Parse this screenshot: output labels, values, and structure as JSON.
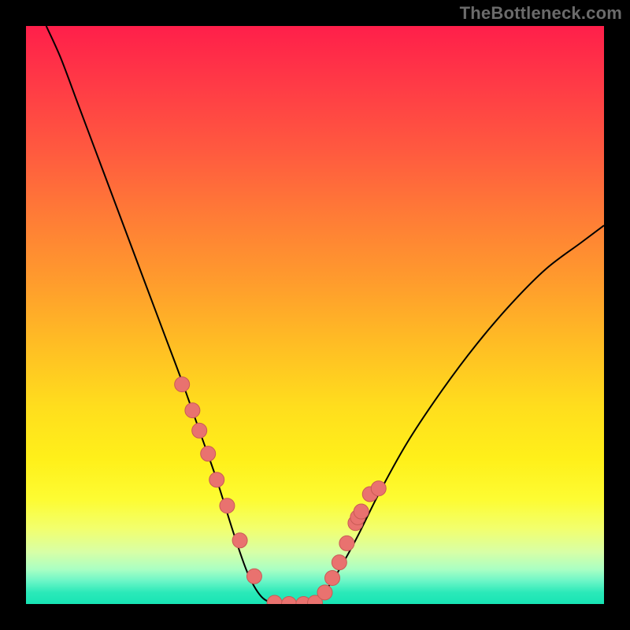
{
  "watermark": "TheBottleneck.com",
  "colors": {
    "background": "#000000",
    "curve_stroke": "#000000",
    "marker_fill": "#e9726f",
    "marker_stroke": "#c95a55",
    "gradient_top": "#ff1f4a",
    "gradient_bottom": "#17e4b4"
  },
  "chart_data": {
    "type": "line",
    "title": "",
    "xlabel": "",
    "ylabel": "",
    "xlim": [
      0,
      1
    ],
    "ylim": [
      0,
      1
    ],
    "y_axis_note": "0 = bottom (green), 1 = top (red); curve shows bottleneck severity vs configuration",
    "curve": {
      "name": "bottleneck-curve",
      "x": [
        0.035,
        0.06,
        0.09,
        0.12,
        0.15,
        0.18,
        0.21,
        0.24,
        0.27,
        0.3,
        0.33,
        0.36,
        0.385,
        0.41,
        0.44,
        0.47,
        0.5,
        0.53,
        0.57,
        0.61,
        0.66,
        0.72,
        0.78,
        0.84,
        0.9,
        0.96,
        1.0
      ],
      "y": [
        1.0,
        0.945,
        0.865,
        0.785,
        0.705,
        0.625,
        0.545,
        0.465,
        0.385,
        0.3,
        0.215,
        0.12,
        0.05,
        0.01,
        0.0,
        0.0,
        0.005,
        0.04,
        0.11,
        0.19,
        0.28,
        0.37,
        0.45,
        0.52,
        0.58,
        0.625,
        0.655
      ]
    },
    "markers": {
      "name": "sample-points",
      "x": [
        0.27,
        0.288,
        0.3,
        0.315,
        0.33,
        0.348,
        0.37,
        0.395,
        0.43,
        0.455,
        0.48,
        0.5,
        0.517,
        0.53,
        0.542,
        0.555,
        0.57,
        0.574,
        0.58,
        0.595,
        0.61
      ],
      "y": [
        0.38,
        0.335,
        0.3,
        0.26,
        0.215,
        0.17,
        0.11,
        0.048,
        0.002,
        0.0,
        0.0,
        0.002,
        0.02,
        0.045,
        0.072,
        0.105,
        0.14,
        0.15,
        0.16,
        0.19,
        0.2
      ]
    }
  }
}
